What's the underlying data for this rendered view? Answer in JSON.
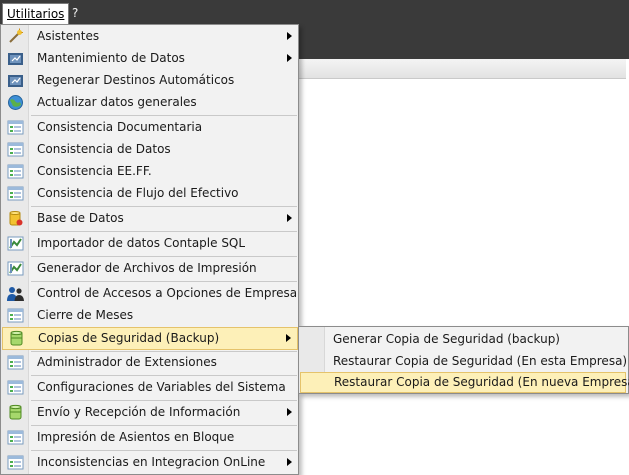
{
  "menubar": {
    "items": [
      {
        "label": "Utilitarios",
        "active": true
      },
      {
        "label": "?",
        "active": false
      }
    ]
  },
  "menu": {
    "items": [
      {
        "label": "Asistentes",
        "icon": "wand-icon",
        "submenu": true
      },
      {
        "label": "Mantenimiento de Datos",
        "icon": "maintenance-icon",
        "submenu": true
      },
      {
        "label": "Regenerar Destinos Automáticos",
        "icon": "regenerate-icon",
        "submenu": false
      },
      {
        "label": "Actualizar datos generales",
        "icon": "globe-icon",
        "submenu": false
      },
      {
        "label": "Consistencia Documentaria",
        "icon": "form-icon",
        "submenu": false
      },
      {
        "label": "Consistencia de Datos",
        "icon": "form-icon",
        "submenu": false
      },
      {
        "label": "Consistencia EE.FF.",
        "icon": "form-icon",
        "submenu": false
      },
      {
        "label": "Consistencia de Flujo del Efectivo",
        "icon": "form-icon",
        "submenu": false
      },
      {
        "label": "Base de Datos",
        "icon": "database-icon",
        "submenu": true
      },
      {
        "label": "Importador de datos Contaple SQL",
        "icon": "import-icon",
        "submenu": false
      },
      {
        "label": "Generador de Archivos de Impresión",
        "icon": "import-icon",
        "submenu": false
      },
      {
        "label": "Control de Accesos a Opciones de Empresa",
        "icon": "users-icon",
        "submenu": false
      },
      {
        "label": "Cierre de Meses",
        "icon": "form-icon",
        "submenu": false
      },
      {
        "label": "Copias de Seguridad (Backup)",
        "icon": "backup-icon",
        "submenu": true,
        "highlighted": true
      },
      {
        "label": "Administrador de Extensiones",
        "icon": "form-icon",
        "submenu": false
      },
      {
        "label": "Configuraciones de Variables del Sistema",
        "icon": "form-icon",
        "submenu": false
      },
      {
        "label": "Envío y Recepción de Información",
        "icon": "backup-icon",
        "submenu": true
      },
      {
        "label": "Impresión de Asientos en Bloque",
        "icon": "form-icon",
        "submenu": false
      },
      {
        "label": "Inconsistencias en Integracion OnLine",
        "icon": "form-icon",
        "submenu": true
      }
    ]
  },
  "submenu": {
    "items": [
      {
        "label": "Generar Copia de Seguridad (backup)"
      },
      {
        "label": "Restaurar Copia de Seguridad (En esta Empresa)"
      },
      {
        "label": "Restaurar Copia de Seguridad (En nueva Empresa)",
        "highlighted": true
      }
    ]
  },
  "colors": {
    "menubar_bg": "#3a3a3a",
    "menu_bg": "#f2f2f2",
    "highlight_bg": "#fdf0b8",
    "highlight_border": "#e5c36b"
  }
}
